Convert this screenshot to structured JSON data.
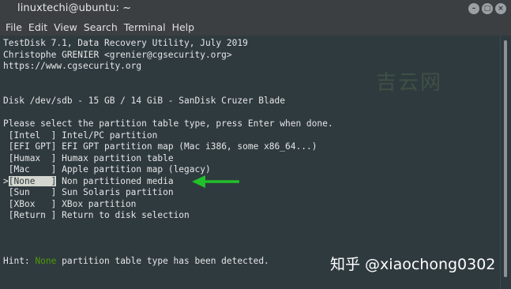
{
  "window": {
    "title": "linuxtechi@ubuntu: ~",
    "buttons": {
      "minimize": "–",
      "maximize": "□",
      "close": "×"
    }
  },
  "menu": [
    "File",
    "Edit",
    "View",
    "Search",
    "Terminal",
    "Help"
  ],
  "terminal": {
    "header": [
      "TestDisk 7.1, Data Recovery Utility, July 2019",
      "Christophe GRENIER <grenier@cgsecurity.org>",
      "https://www.cgsecurity.org"
    ],
    "disk": "Disk /dev/sdb - 15 GB / 14 GiB - SanDisk Cruzer Blade",
    "prompt": "Please select the partition table type, press Enter when done.",
    "options": [
      {
        "key": "[Intel  ]",
        "desc": "Intel/PC partition",
        "selected": false
      },
      {
        "key": "[EFI GPT]",
        "desc": "EFI GPT partition map (Mac i386, some x86_64...)",
        "selected": false
      },
      {
        "key": "[Humax  ]",
        "desc": "Humax partition table",
        "selected": false
      },
      {
        "key": "[Mac    ]",
        "desc": "Apple partition map (legacy)",
        "selected": false
      },
      {
        "key": "[None   ]",
        "desc": "Non partitioned media",
        "selected": true
      },
      {
        "key": "[Sun    ]",
        "desc": "Sun Solaris partition",
        "selected": false
      },
      {
        "key": "[XBox   ]",
        "desc": "XBox partition",
        "selected": false
      },
      {
        "key": "[Return ]",
        "desc": "Return to disk selection",
        "selected": false
      }
    ],
    "selection_marker": ">",
    "hint": {
      "prefix": "Hint: ",
      "highlight": "None",
      "suffix": " partition table type has been detected."
    }
  },
  "watermarks": {
    "faint": "吉云网",
    "bottom": "知乎 @xiaochong0302"
  },
  "colors": {
    "terminal_bg": "#2f3a3f",
    "terminal_fg": "#e6e6e6",
    "hint_green": "#4e9a06",
    "arrow_green": "#22c02a"
  }
}
